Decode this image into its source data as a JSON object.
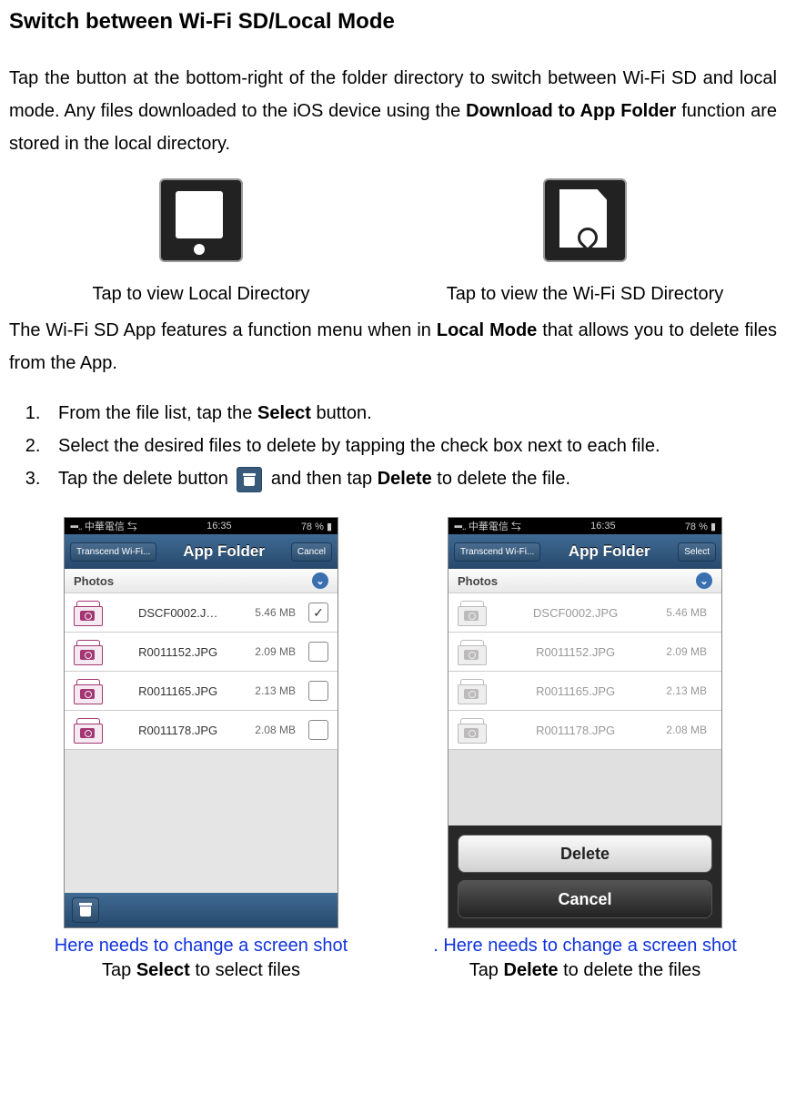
{
  "heading": "Switch between Wi-Fi SD/Local Mode",
  "intro": {
    "part1": "Tap the button at the bottom-right of the folder directory to switch between Wi-Fi SD and local mode. Any files downloaded to the iOS device using the ",
    "bold1": "Download to App Folder",
    "part2": " function are stored in the local directory."
  },
  "icons": {
    "local_caption": "Tap to view Local Directory",
    "wifi_caption": "Tap to view the Wi-Fi SD Directory"
  },
  "para2": {
    "part1": "The Wi-Fi SD App features a function menu when in ",
    "bold": "Local Mode",
    "part2": " that allows you to delete files from the App."
  },
  "steps": {
    "s1a": "From the file list, tap the ",
    "s1b": "Select",
    "s1c": " button.",
    "s2": "Select the desired files to delete by tapping the check box next to each file.",
    "s3a": "Tap the delete button ",
    "s3b": " and then tap ",
    "s3c": "Delete",
    "s3d": " to delete the file."
  },
  "status": {
    "carrier": "中華電信",
    "time": "16:35",
    "battery": "78 %"
  },
  "nav": {
    "back": "Transcend Wi-Fi...",
    "title": "App Folder",
    "cancel": "Cancel",
    "select": "Select"
  },
  "section": "Photos",
  "files": [
    {
      "name": "DSCF0002.J…",
      "size": "5.46 MB",
      "checked": true
    },
    {
      "name": "R0011152.JPG",
      "size": "2.09 MB",
      "checked": false
    },
    {
      "name": "R0011165.JPG",
      "size": "2.13 MB",
      "checked": false
    },
    {
      "name": "R0011178.JPG",
      "size": "2.08 MB",
      "checked": false
    }
  ],
  "files2": [
    {
      "name": "DSCF0002.JPG",
      "size": "5.46 MB"
    },
    {
      "name": "R0011152.JPG",
      "size": "2.09 MB"
    },
    {
      "name": "R0011165.JPG",
      "size": "2.13 MB"
    },
    {
      "name": "R0011178.JPG",
      "size": "2.08 MB"
    }
  ],
  "actions": {
    "delete": "Delete",
    "cancel": "Cancel"
  },
  "notes": {
    "left_blue": "Here needs to change a screen shot",
    "right_blue": ". Here needs to change a screen shot",
    "left_cap_a": "Tap ",
    "left_cap_b": "Select",
    "left_cap_c": " to select files",
    "right_cap_a": "Tap ",
    "right_cap_b": "Delete",
    "right_cap_c": " to delete the files"
  }
}
